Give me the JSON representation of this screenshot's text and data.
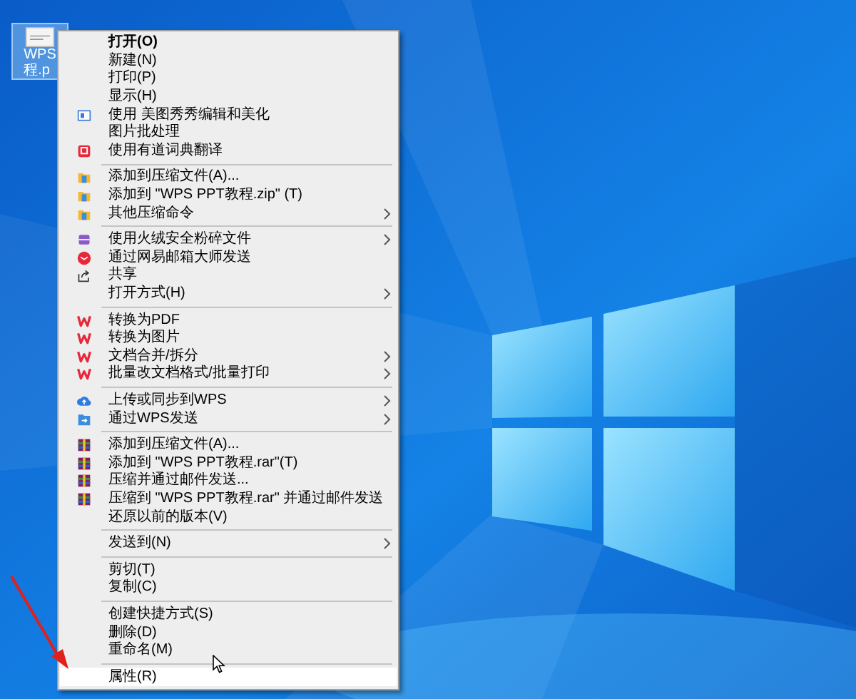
{
  "desktop_icon": {
    "label_lines": [
      "WPS",
      "程.p"
    ],
    "selected": true
  },
  "context_menu": {
    "sections": [
      {
        "items": [
          {
            "label": "打开(O)",
            "kind": "plain",
            "default": true,
            "submenu": false,
            "selected": false
          },
          {
            "label": "新建(N)",
            "kind": "plain",
            "default": false,
            "submenu": false,
            "selected": false
          },
          {
            "label": "打印(P)",
            "kind": "plain",
            "default": false,
            "submenu": false,
            "selected": false
          },
          {
            "label": "显示(H)",
            "kind": "plain",
            "default": false,
            "submenu": false,
            "selected": false
          },
          {
            "label": "使用 美图秀秀编辑和美化",
            "kind": "meitu",
            "default": false,
            "submenu": false,
            "selected": false
          },
          {
            "label": "图片批处理",
            "kind": "plain",
            "default": false,
            "submenu": false,
            "selected": false
          },
          {
            "label": "使用有道词典翻译",
            "kind": "youdao",
            "default": false,
            "submenu": false,
            "selected": false
          }
        ]
      },
      {
        "items": [
          {
            "label": "添加到压缩文件(A)...",
            "kind": "zip",
            "default": false,
            "submenu": false,
            "selected": false
          },
          {
            "label": "添加到 \"WPS PPT教程.zip\" (T)",
            "kind": "zip",
            "default": false,
            "submenu": false,
            "selected": false
          },
          {
            "label": "其他压缩命令",
            "kind": "zip",
            "default": false,
            "submenu": true,
            "selected": false
          }
        ]
      },
      {
        "items": [
          {
            "label": "使用火绒安全粉碎文件",
            "kind": "shredder",
            "default": false,
            "submenu": true,
            "selected": false
          },
          {
            "label": "通过网易邮箱大师发送",
            "kind": "mail",
            "default": false,
            "submenu": false,
            "selected": false
          },
          {
            "label": "共享",
            "kind": "share",
            "default": false,
            "submenu": false,
            "selected": false
          },
          {
            "label": "打开方式(H)",
            "kind": "plain",
            "default": false,
            "submenu": true,
            "selected": false
          }
        ]
      },
      {
        "items": [
          {
            "label": "转换为PDF",
            "kind": "wps",
            "default": false,
            "submenu": false,
            "selected": false
          },
          {
            "label": "转换为图片",
            "kind": "wps",
            "default": false,
            "submenu": false,
            "selected": false
          },
          {
            "label": "文档合并/拆分",
            "kind": "wps",
            "default": false,
            "submenu": true,
            "selected": false
          },
          {
            "label": "批量改文档格式/批量打印",
            "kind": "wps",
            "default": false,
            "submenu": true,
            "selected": false
          }
        ]
      },
      {
        "items": [
          {
            "label": "上传或同步到WPS",
            "kind": "cloud",
            "default": false,
            "submenu": true,
            "selected": false
          },
          {
            "label": "通过WPS发送",
            "kind": "send",
            "default": false,
            "submenu": true,
            "selected": false
          }
        ]
      },
      {
        "items": [
          {
            "label": "添加到压缩文件(A)...",
            "kind": "rar",
            "default": false,
            "submenu": false,
            "selected": false
          },
          {
            "label": "添加到 \"WPS PPT教程.rar\"(T)",
            "kind": "rar",
            "default": false,
            "submenu": false,
            "selected": false
          },
          {
            "label": "压缩并通过邮件发送...",
            "kind": "rar",
            "default": false,
            "submenu": false,
            "selected": false
          },
          {
            "label": "压缩到 \"WPS PPT教程.rar\" 并通过邮件发送",
            "kind": "rar",
            "default": false,
            "submenu": false,
            "selected": false
          },
          {
            "label": "还原以前的版本(V)",
            "kind": "plain",
            "default": false,
            "submenu": false,
            "selected": false
          }
        ]
      },
      {
        "items": [
          {
            "label": "发送到(N)",
            "kind": "plain",
            "default": false,
            "submenu": true,
            "selected": false
          }
        ]
      },
      {
        "items": [
          {
            "label": "剪切(T)",
            "kind": "plain",
            "default": false,
            "submenu": false,
            "selected": false
          },
          {
            "label": "复制(C)",
            "kind": "plain",
            "default": false,
            "submenu": false,
            "selected": false
          }
        ]
      },
      {
        "items": [
          {
            "label": "创建快捷方式(S)",
            "kind": "plain",
            "default": false,
            "submenu": false,
            "selected": false
          },
          {
            "label": "删除(D)",
            "kind": "plain",
            "default": false,
            "submenu": false,
            "selected": false
          },
          {
            "label": "重命名(M)",
            "kind": "plain",
            "default": false,
            "submenu": false,
            "selected": false
          }
        ]
      },
      {
        "items": [
          {
            "label": "属性(R)",
            "kind": "plain",
            "default": false,
            "submenu": false,
            "selected": true
          }
        ]
      }
    ]
  }
}
